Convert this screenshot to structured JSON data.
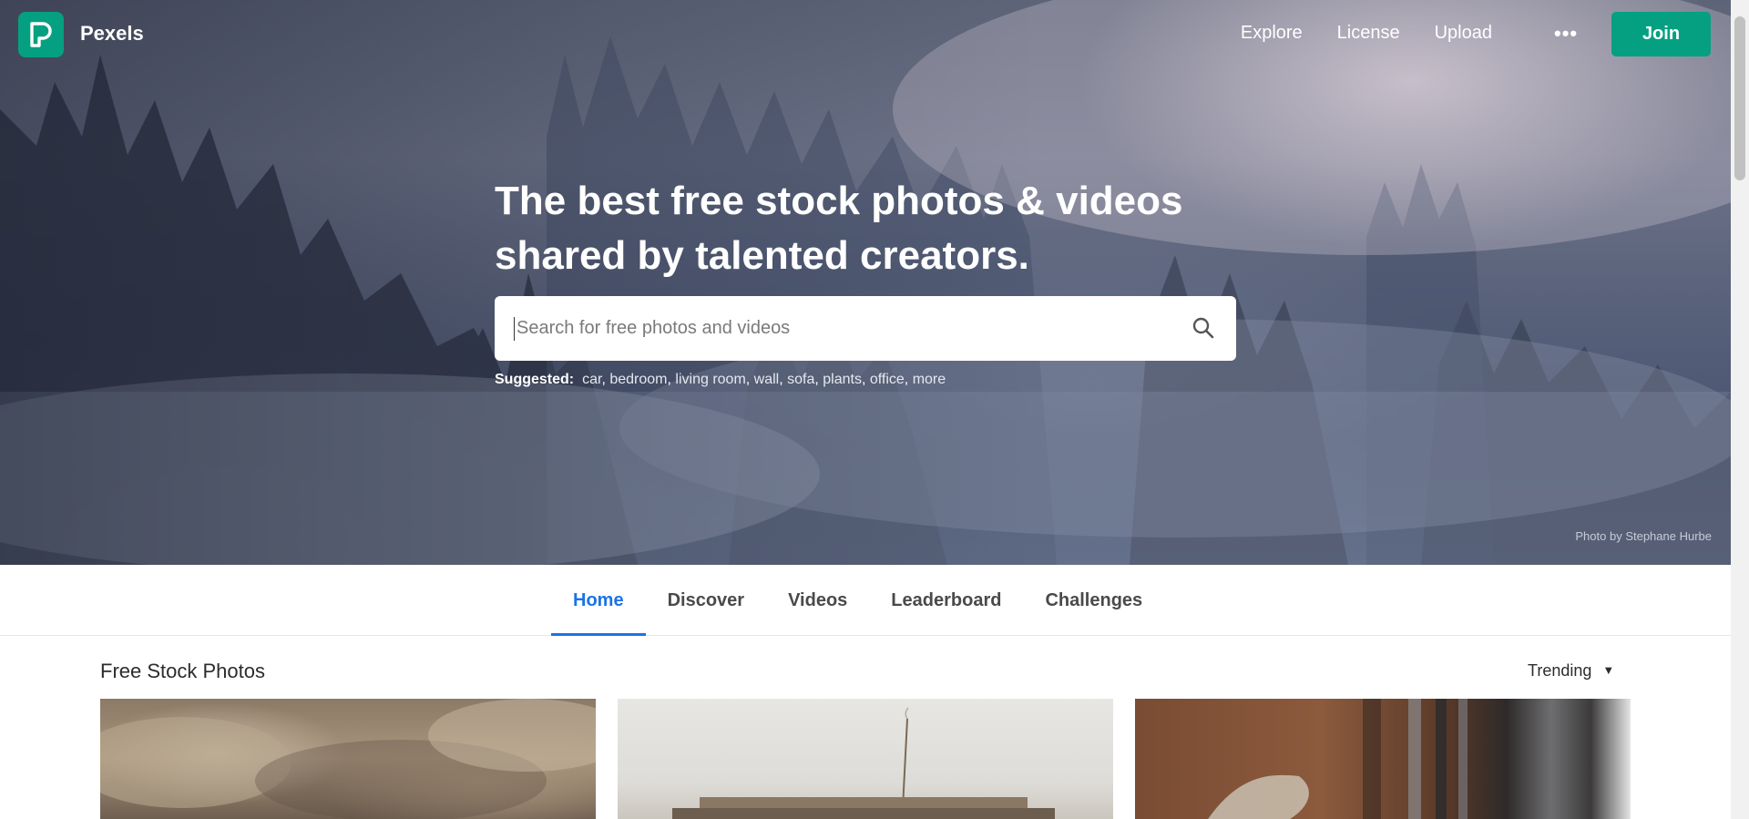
{
  "brand": {
    "name": "Pexels",
    "logo_color": "#05a081"
  },
  "nav": {
    "links": [
      "Explore",
      "License",
      "Upload"
    ],
    "more_label": "•••",
    "join_label": "Join",
    "accent": "#05a081"
  },
  "hero": {
    "headline_line1": "The best free stock photos & videos",
    "headline_line2": "shared by talented creators.",
    "search_placeholder": "Search for free photos and videos",
    "search_value": "",
    "suggested_label": "Suggested:",
    "suggestions": [
      "car",
      "bedroom",
      "living room",
      "wall",
      "sofa",
      "plants",
      "office",
      "more"
    ],
    "photo_credit": "Photo by Stephane Hurbe"
  },
  "tabs": {
    "items": [
      "Home",
      "Discover",
      "Videos",
      "Leaderboard",
      "Challenges"
    ],
    "active": "Home",
    "active_color": "#1a73e8"
  },
  "content": {
    "section_title": "Free Stock Photos",
    "sort_label": "Trending",
    "photo_count_visible": 3
  },
  "icons": {
    "logo": "pexels-logo-icon",
    "search": "search-icon",
    "more": "more-dots-icon",
    "sort_caret": "caret-down-icon"
  }
}
